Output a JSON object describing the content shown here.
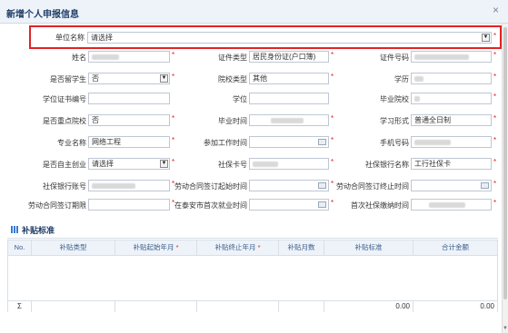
{
  "dialog": {
    "title": "新增个人申报信息",
    "close": "×"
  },
  "form": {
    "unit_label": "单位名称",
    "unit_value": "请选择",
    "name_label": "姓名",
    "id_type_label": "证件类型",
    "id_type_value": "居民身份证(户口簿)",
    "id_no_label": "证件号码",
    "returnee_label": "是否留学生",
    "returnee_value": "否",
    "school_type_label": "院校类型",
    "school_type_value": "其他",
    "edu_label": "学历",
    "degree_no_label": "学位证书编号",
    "degree_label": "学位",
    "grad_school_label": "毕业院校",
    "key_school_label": "是否重点院校",
    "key_school_value": "否",
    "grad_time_label": "毕业时间",
    "study_form_label": "学习形式",
    "study_form_value": "普通全日制",
    "major_label": "专业名称",
    "major_value": "网络工程",
    "work_start_label": "参加工作时间",
    "phone_label": "手机号码",
    "self_emp_label": "是否自主创业",
    "self_emp_value": "请选择",
    "ss_card_label": "社保卡号",
    "ss_bank_label": "社保银行名称",
    "ss_bank_value": "工行社保卡",
    "ss_account_label": "社保银行账号",
    "contract_start_label": "劳动合同签订起始时间",
    "contract_end_label": "劳动合同签订终止时间",
    "contract_term_label": "劳动合同签订期限",
    "first_job_label": "在泰安市首次就业时间",
    "first_ss_label": "首次社保缴纳时间"
  },
  "subsidy": {
    "section_title": "补贴标准",
    "columns": [
      "No.",
      "补贴类型",
      "补贴起始年月",
      "补贴终止年月",
      "补贴月数",
      "补贴标准",
      "合计金额"
    ],
    "required_marks": [
      "",
      "",
      "*",
      "*",
      "",
      "",
      ""
    ],
    "summary": {
      "symbol": "Σ",
      "standard": "0.00",
      "total": "0.00"
    }
  },
  "icons": {
    "select": "chevron-down-icon",
    "calendar": "calendar-icon",
    "close": "close-icon",
    "section": "grid-icon"
  },
  "colors": {
    "required": "#e02020",
    "highlight": "#e02424",
    "header_text": "#1f3d66"
  }
}
